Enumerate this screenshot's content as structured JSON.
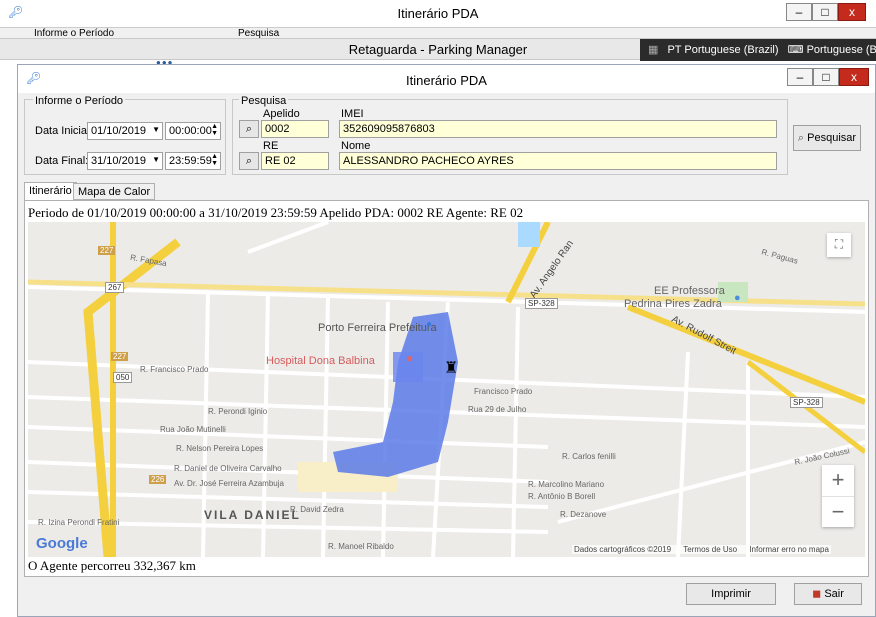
{
  "background_window": {
    "title": "Itinerário PDA",
    "group_period": "Informe o Período",
    "group_search": "Pesquisa"
  },
  "taskbar": {
    "title": "Retaguarda - Parking Manager",
    "lang_code": "PT Portuguese (Brazil)",
    "keyboard": "Portuguese (Brazil"
  },
  "window": {
    "title": "Itinerário PDA",
    "controls": {
      "minimize": "–",
      "maximize": "□",
      "close": "x"
    },
    "period": {
      "group_label": "Informe o Período",
      "start_label": "Data Inicial:",
      "start_date": "01/10/2019",
      "start_time": "00:00:00",
      "end_label": "Data Final:",
      "end_date": "31/10/2019",
      "end_time": "23:59:59"
    },
    "search": {
      "group_label": "Pesquisa",
      "apelido_label": "Apelido",
      "apelido_value": "0002",
      "imei_label": "IMEI",
      "imei_value": "352609095876803",
      "re_label": "RE",
      "re_value": "RE 02",
      "nome_label": "Nome",
      "nome_value": "ALESSANDRO PACHECO AYRES",
      "button": "Pesquisar"
    },
    "tabs": [
      {
        "label": "Itinerário",
        "active": true
      },
      {
        "label": "Mapa de Calor",
        "active": false
      }
    ],
    "info_line": "Periodo de 01/10/2019 00:00:00 a 31/10/2019 23:59:59  Apelido PDA: 0002  RE Agente: RE 02",
    "footer_line": "O Agente percorreu 332,367 km",
    "buttons": {
      "print": "Imprimir",
      "exit": "Sair"
    }
  },
  "map": {
    "labels": {
      "prefeitura": "Porto Ferreira Prefeitura",
      "hospital": "Hospital Dona Balbina",
      "school": "EE Professora",
      "school2": "Pedrina Pires Zadra",
      "vila": "VILA DANIEL",
      "avenue1": "Av. Angelo Ran",
      "avenue2": "Av. Rudolf Streit",
      "sp328a": "SP-328",
      "sp328b": "SP-328",
      "r227a": "227",
      "r227b": "227",
      "r267": "267",
      "r050": "050",
      "r226": "226",
      "fprado": "R. Francisco Prado",
      "fprado2": "Francisco Prado",
      "perondi": "R. Perondi Iginio",
      "mutinelli": "Rua João Mutinelli",
      "nelson": "R. Nelson Pereira Lopes",
      "daniel": "R. Daniel de Oliveira Carvalho",
      "azambuja": "Av. Dr. José Ferreira Azambuja",
      "izina": "R. Izina Perondi Fratini",
      "julho": "Rua 29 de Julho",
      "fenilli": "R. Carlos fenilli",
      "marcolino": "R. Marcolino Mariano",
      "borell": "R. Antônio B Borell",
      "dezanove": "R. Dezanove",
      "ribaldo": "R. Manoel Ribaldo",
      "zedra": "R. David Zedra",
      "colussi": "R. João Colussi",
      "paguas": "R. Paguas",
      "fapasa": "R. Fapasa",
      "google": "Google",
      "attribution": "Dados cartográficos ©2019",
      "terms": "Termos de Uso",
      "report": "Informar erro no mapa"
    },
    "zoom_in": "+",
    "zoom_out": "−",
    "fullscreen_icon": "fullscreen-icon"
  }
}
